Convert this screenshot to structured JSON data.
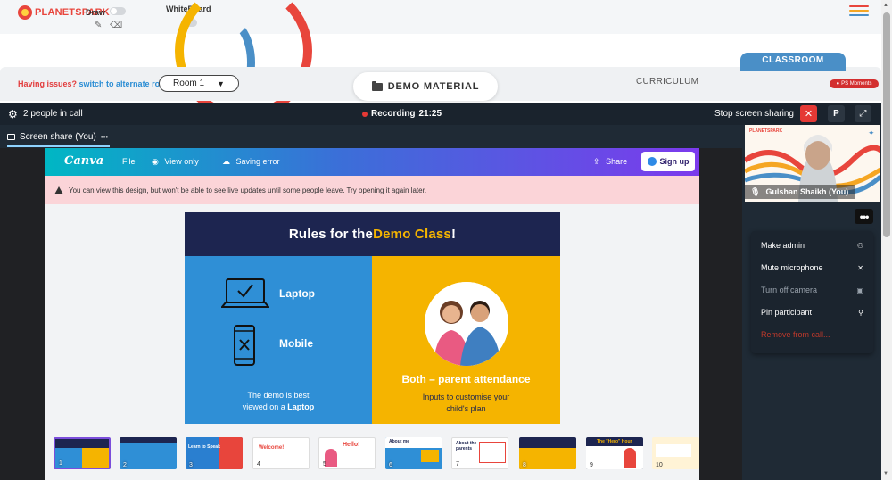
{
  "topbar": {
    "brand": "PLANETSPARK",
    "draw_label": "Draw",
    "whiteboard_label": "WhiteBoard",
    "hamburger_colors": [
      "#e8453c",
      "#f5a623",
      "#4a8fc7"
    ]
  },
  "subnav": {
    "issues_text": "Having issues?",
    "alternate_link": "switch to alternate room",
    "room": "Room 1",
    "demo_material": "DEMO MATERIAL",
    "curriculum": "CURRICULUM",
    "classroom": "CLASSROOM",
    "moments": "PS Moments"
  },
  "call": {
    "people": "2 people in call",
    "recording_label": "Recording",
    "recording_time": "21:25",
    "stop_sharing": "Stop screen sharing",
    "p_label": "P",
    "screen_share_tab": "Screen share (You)",
    "screen_share_more": "•••"
  },
  "canva": {
    "logo": "Canva",
    "file": "File",
    "view_only": "View only",
    "saving_error": "Saving error",
    "share": "Share",
    "sign_up": "Sign up",
    "warning": "You can view this design, but won't be able to see live updates until some people leave. Try opening it again later."
  },
  "slide": {
    "title_prefix": "Rules for the ",
    "title_highlight": "Demo Class",
    "title_suffix": "!",
    "laptop": "Laptop",
    "mobile": "Mobile",
    "demo_best": "The demo is best",
    "viewed_on": "viewed on a ",
    "viewed_device": "Laptop",
    "both": "Both – parent attendance",
    "inputs_line1": "Inputs to customise your",
    "inputs_line2": "child's plan"
  },
  "thumbnails": [
    {
      "num": "1",
      "label": "",
      "color": "#1d2550"
    },
    {
      "num": "2",
      "label": "",
      "color": "#2f8fd6"
    },
    {
      "num": "3",
      "label": "Learn to Speak",
      "color": "#2a7fd0"
    },
    {
      "num": "4",
      "label": "Welcome!",
      "color": "#ffffff"
    },
    {
      "num": "5",
      "label": "Hello!",
      "color": "#ffffff"
    },
    {
      "num": "6",
      "label": "About me",
      "color": "#2f8fd6"
    },
    {
      "num": "7",
      "label": "About the parents",
      "color": "#ffffff"
    },
    {
      "num": "8",
      "label": "",
      "color": "#1d2550"
    },
    {
      "num": "9",
      "label": "The \"Hero\" Hour",
      "color": "#1d2550"
    },
    {
      "num": "10",
      "label": "",
      "color": "#fff3d6"
    }
  ],
  "participant": {
    "brand": "PLANETSPARK",
    "name": "Gulshan Shaikh (You)",
    "more": "•••"
  },
  "menu": [
    {
      "label": "Make admin",
      "icon": "👤",
      "color": "#ffffff"
    },
    {
      "label": "Mute microphone",
      "icon": "✕",
      "color": "#ffffff"
    },
    {
      "label": "Turn off camera",
      "icon": "■",
      "color": "#9aa3ad"
    },
    {
      "label": "Pin participant",
      "icon": "📌",
      "color": "#ffffff"
    },
    {
      "label": "Remove from call...",
      "icon": "",
      "color": "#c0392b"
    }
  ]
}
